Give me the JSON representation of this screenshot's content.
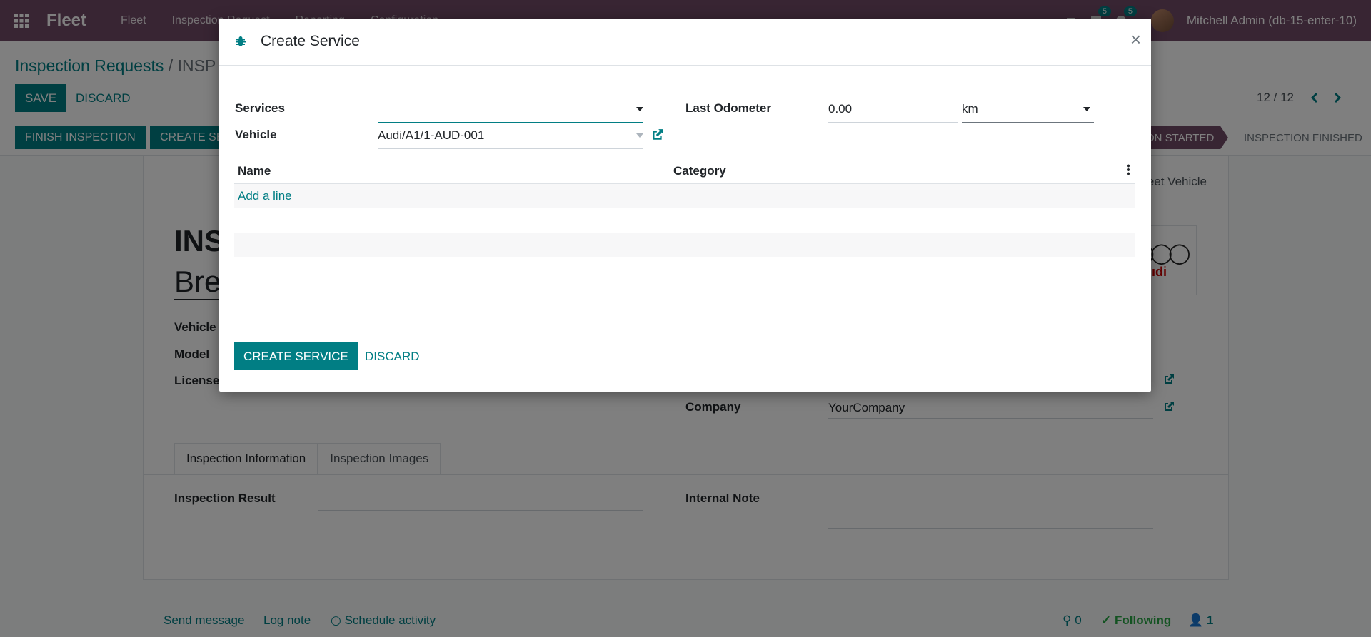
{
  "navbar": {
    "brand": "Fleet",
    "menu": [
      "Fleet",
      "Inspection Request",
      "Reporting",
      "Configuration"
    ],
    "messages_count": "5",
    "activities_count": "5",
    "user": "Mitchell Admin (db-15-enter-10)"
  },
  "control_panel": {
    "breadcrumb_parent": "Inspection Requests",
    "breadcrumb_sep": "/",
    "breadcrumb_current": "INSP",
    "save_label": "SAVE",
    "discard_label": "DISCARD",
    "pager": "12 / 12"
  },
  "status_bar": {
    "finish_label": "FINISH INSPECTION",
    "create_service_label": "CREATE SE",
    "stage_started": "ON STARTED",
    "stage_finished": "INSPECTION FINISHED"
  },
  "form": {
    "fleet_vehicle_button": "eet Vehicle",
    "title": "INS",
    "subtitle": "Bre",
    "logo_rings": "◯◯◯",
    "logo_text": "ıdi",
    "vehicle_label": "Vehicle",
    "model_label": "Model",
    "license_label": "License",
    "company_label": "Company",
    "company_value": "YourCompany",
    "tabs": [
      "Inspection Information",
      "Inspection Images"
    ],
    "inspection_result_label": "Inspection Result",
    "internal_note_label": "Internal Note"
  },
  "chatter": {
    "send_message": "Send message",
    "log_note": "Log note",
    "schedule_activity": "Schedule activity",
    "attachments": "0",
    "following": "Following",
    "followers": "1"
  },
  "modal": {
    "title": "Create Service",
    "close": "×",
    "services_label": "Services",
    "services_value": "",
    "vehicle_label": "Vehicle",
    "vehicle_value": "Audi/A1/1-AUD-001",
    "last_odometer_label": "Last Odometer",
    "odometer_value": "0.00",
    "odometer_unit": "km",
    "columns": [
      "Name",
      "Category"
    ],
    "add_line": "Add a line",
    "create_label": "CREATE SERVICE",
    "discard_label": "DISCARD"
  },
  "colors": {
    "primary": "#714B67",
    "accent": "#017e84"
  }
}
